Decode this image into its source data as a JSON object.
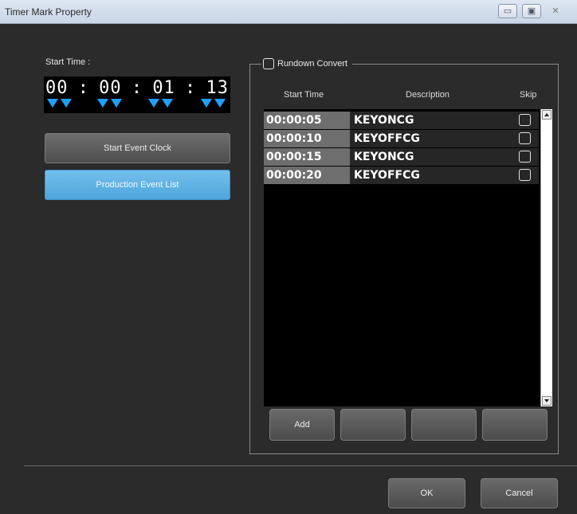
{
  "window": {
    "title": "Timer Mark Property",
    "minimize_glyph": "▭",
    "maximize_glyph": "▣",
    "close_glyph": "✕"
  },
  "start_time": {
    "label": "Start Time :",
    "timecode": [
      "00",
      ":",
      "00",
      ":",
      "01",
      ":",
      "13"
    ],
    "arrow_color": "#1fa0ff"
  },
  "buttons": {
    "start_event_clock": "Start Event Clock",
    "production_event_list": "Production Event List",
    "ok": "OK",
    "cancel": "Cancel"
  },
  "rundown": {
    "convert_label": "Rundown Convert",
    "convert_checked": false,
    "columns": {
      "start_time": "Start Time",
      "description": "Description",
      "skip": "Skip"
    },
    "rows": [
      {
        "start_time": "00:00:05",
        "description": "KEYONCG",
        "skip": false
      },
      {
        "start_time": "00:00:10",
        "description": "KEYOFFCG",
        "skip": false
      },
      {
        "start_time": "00:00:15",
        "description": "KEYONCG",
        "skip": false
      },
      {
        "start_time": "00:00:20",
        "description": "KEYOFFCG",
        "skip": false
      }
    ],
    "list_buttons": [
      "Add",
      "",
      "",
      ""
    ]
  },
  "colors": {
    "accent_blue": "#4ea6da",
    "background": "#2b2b2b"
  }
}
